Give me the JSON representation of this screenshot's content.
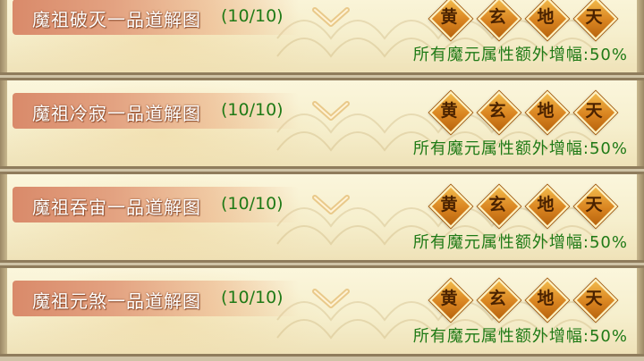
{
  "rows": [
    {
      "title": "魔祖破灭一品道解图",
      "progress": "(10/10)",
      "grades": [
        "黄",
        "玄",
        "地",
        "天"
      ],
      "bonus": "所有魔元属性额外增幅:50%"
    },
    {
      "title": "魔祖冷寂一品道解图",
      "progress": "(10/10)",
      "grades": [
        "黄",
        "玄",
        "地",
        "天"
      ],
      "bonus": "所有魔元属性额外增幅:50%"
    },
    {
      "title": "魔祖吞宙一品道解图",
      "progress": "(10/10)",
      "grades": [
        "黄",
        "玄",
        "地",
        "天"
      ],
      "bonus": "所有魔元属性额外增幅:50%"
    },
    {
      "title": "魔祖元煞一品道解图",
      "progress": "(10/10)",
      "grades": [
        "黄",
        "玄",
        "地",
        "天"
      ],
      "bonus": "所有魔元属性额外增幅:50%"
    }
  ],
  "icons": {
    "expand": "chevron-down-icon",
    "grade": "diamond-badge-icon"
  },
  "colors": {
    "progress_text": "#1f7a16",
    "bonus_text": "#1f7a16",
    "title_text": "#ffffff",
    "badge_fill": "#d98420"
  }
}
